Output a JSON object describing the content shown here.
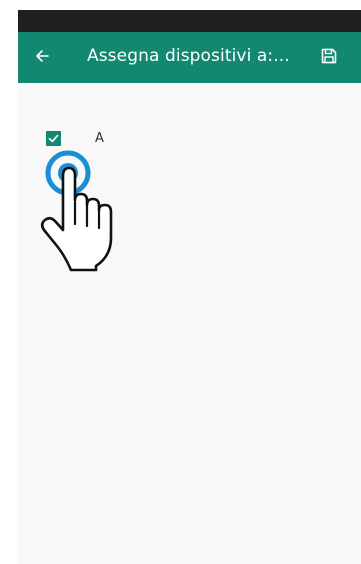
{
  "app_bar": {
    "title": "Assegna dispositivi a:...",
    "back_icon": "arrow-left-icon",
    "save_icon": "floppy-disk-icon",
    "color": "#11886f"
  },
  "list": {
    "items": [
      {
        "label": "A",
        "checked": true
      }
    ]
  },
  "overlay": {
    "icon": "tap-hand-icon",
    "ring_color": "#1a8fd6"
  }
}
